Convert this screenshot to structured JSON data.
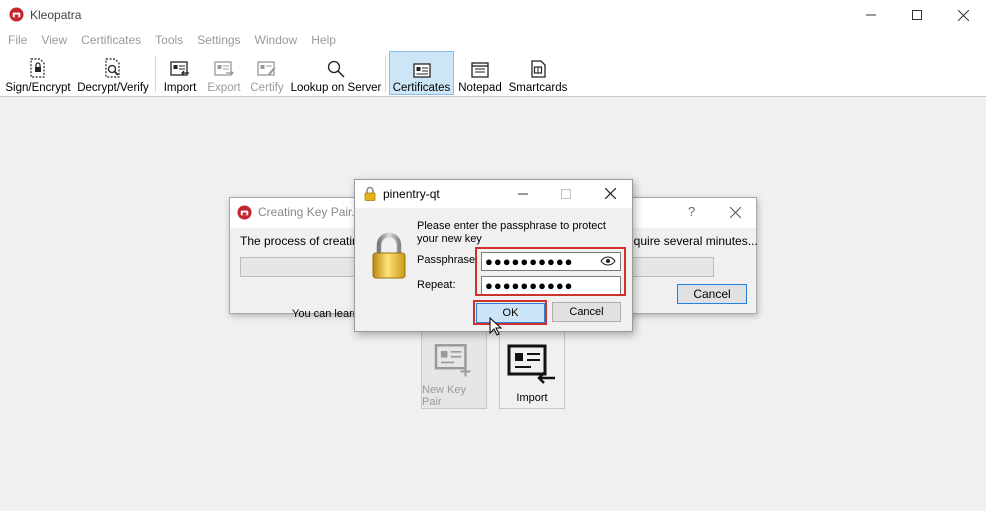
{
  "window": {
    "title": "Kleopatra",
    "controls": [
      "minimize-icon",
      "maximize-icon",
      "close-icon"
    ]
  },
  "menubar": {
    "items": [
      "File",
      "View",
      "Certificates",
      "Tools",
      "Settings",
      "Window",
      "Help"
    ]
  },
  "toolbar": {
    "buttons": [
      {
        "label": "Sign/Encrypt",
        "icon": "sign-encrypt-icon",
        "enabled": true
      },
      {
        "label": "Decrypt/Verify",
        "icon": "decrypt-verify-icon",
        "enabled": true
      },
      {
        "label": "Import",
        "icon": "import-icon",
        "enabled": true
      },
      {
        "label": "Export",
        "icon": "export-icon",
        "enabled": false
      },
      {
        "label": "Certify",
        "icon": "certify-icon",
        "enabled": false
      },
      {
        "label": "Lookup on Server",
        "icon": "search-icon",
        "enabled": true
      },
      {
        "label": "Certificates",
        "icon": "certificates-icon",
        "enabled": true,
        "active": true
      },
      {
        "label": "Notepad",
        "icon": "notepad-icon",
        "enabled": true
      },
      {
        "label": "Smartcards",
        "icon": "smartcard-icon",
        "enabled": true
      }
    ]
  },
  "background": {
    "learn_text": "You can learn",
    "new_key_pair_label": "New Key Pair",
    "import_label": "Import"
  },
  "creating_dialog": {
    "title": "Creating Key Pair...",
    "message_left": "The process of creating a",
    "message_right": "equire several minutes...",
    "help_button": "?",
    "cancel_label": "Cancel"
  },
  "pinentry": {
    "title": "pinentry-qt",
    "description": "Please enter the passphrase to protect your new key",
    "passphrase_label": "Passphrase:",
    "passphrase_value": "●●●●●●●●●●",
    "repeat_label": "Repeat:",
    "repeat_value": "●●●●●●●●●●",
    "ok_label": "OK",
    "cancel_label": "Cancel"
  },
  "colors": {
    "highlight": "#d0312d",
    "active_toolbar": "#cde6f7",
    "focus_border": "#2a7fd4"
  }
}
